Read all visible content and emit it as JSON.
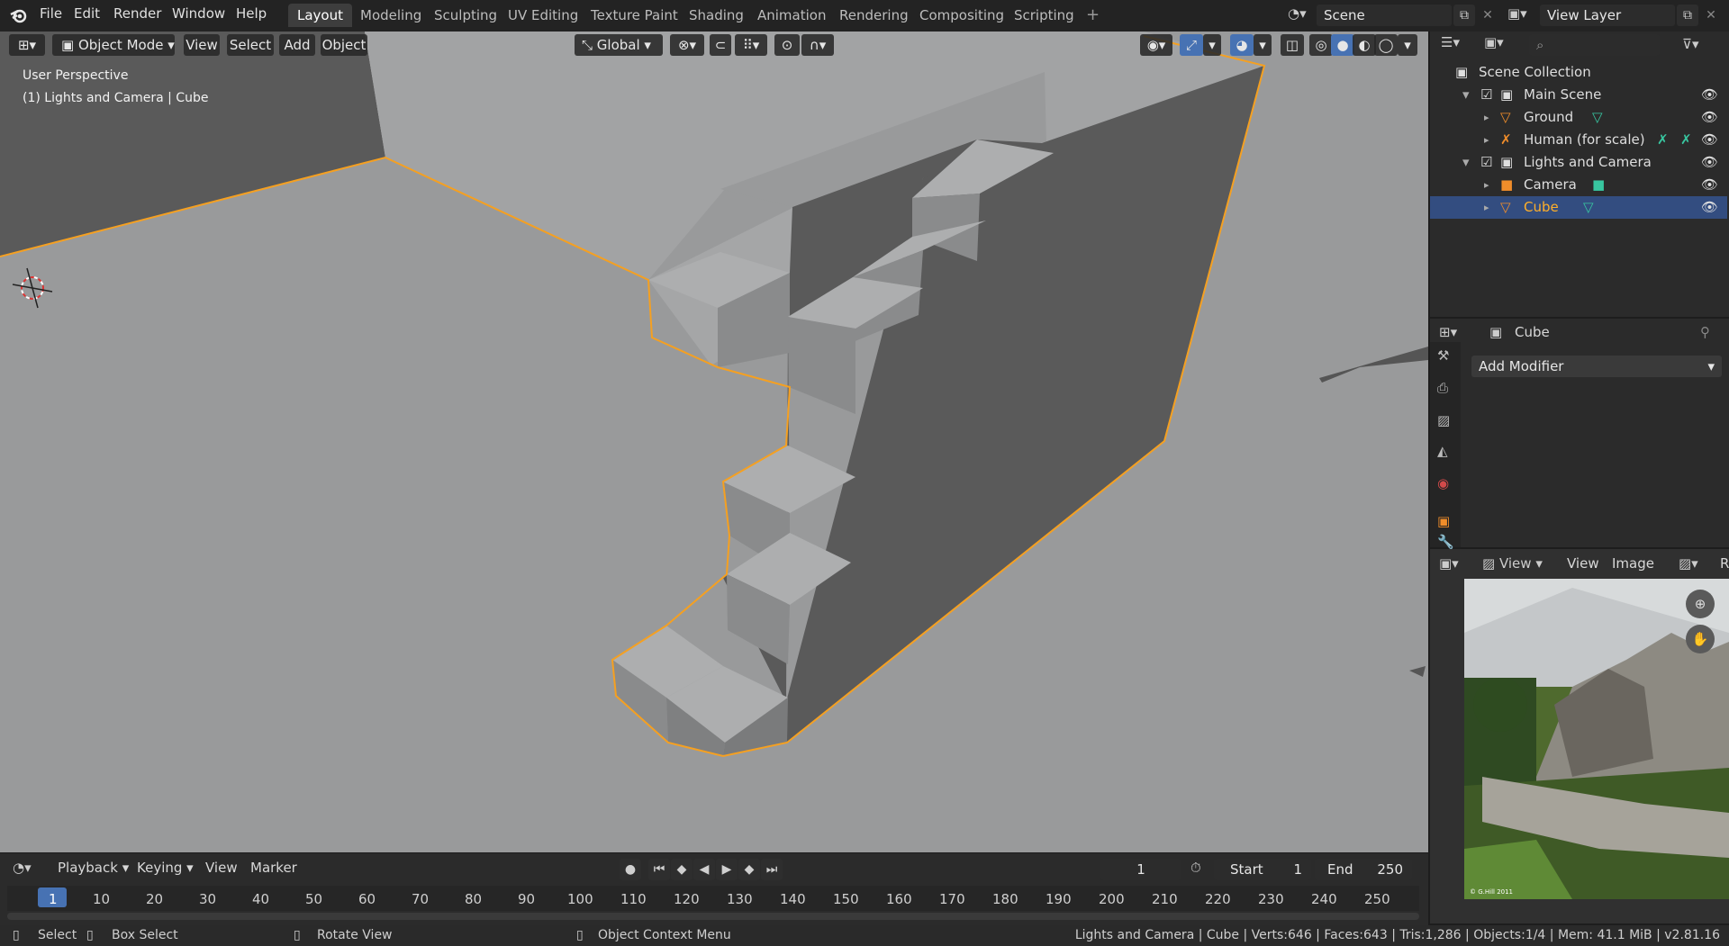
{
  "menu": {
    "file": "File",
    "edit": "Edit",
    "render": "Render",
    "window": "Window",
    "help": "Help"
  },
  "workspaces": [
    "Layout",
    "Modeling",
    "Sculpting",
    "UV Editing",
    "Texture Paint",
    "Shading",
    "Animation",
    "Rendering",
    "Compositing",
    "Scripting"
  ],
  "add_workspace": "+",
  "scene_field": "Scene",
  "view_layer_field": "View Layer",
  "viewport_header": {
    "mode": "Object Mode",
    "view": "View",
    "select": "Select",
    "add": "Add",
    "object": "Object",
    "orientation": "Global"
  },
  "viewport_overlay": {
    "perspective": "User Perspective",
    "context": "(1) Lights and Camera | Cube"
  },
  "outliner": {
    "root": "Scene Collection",
    "items": [
      {
        "label": "Main Scene",
        "type": "collection"
      },
      {
        "label": "Ground",
        "type": "mesh"
      },
      {
        "label": "Human (for scale)",
        "type": "armature"
      },
      {
        "label": "Lights and Camera",
        "type": "collection"
      },
      {
        "label": "Camera",
        "type": "camera"
      },
      {
        "label": "Cube",
        "type": "mesh",
        "selected": true
      }
    ]
  },
  "properties": {
    "object_name": "Cube",
    "add_modifier": "Add Modifier"
  },
  "image_editor": {
    "view_menu": "View",
    "view": "View",
    "image": "Image",
    "r": "R",
    "watermark": "© G.Hill 2011"
  },
  "timeline": {
    "playback": "Playback",
    "keying": "Keying",
    "view": "View",
    "marker": "Marker",
    "current_frame": "1",
    "start_label": "Start",
    "start_value": "1",
    "end_label": "End",
    "end_value": "250",
    "ruler": [
      "1",
      "10",
      "20",
      "30",
      "40",
      "50",
      "60",
      "70",
      "80",
      "90",
      "100",
      "110",
      "120",
      "130",
      "140",
      "150",
      "160",
      "170",
      "180",
      "190",
      "200",
      "210",
      "220",
      "230",
      "240",
      "250"
    ]
  },
  "statusbar": {
    "select": "Select",
    "box_select": "Box Select",
    "rotate_view": "Rotate View",
    "context_menu": "Object Context Menu",
    "stats": "Lights and Camera | Cube | Verts:646 | Faces:643 | Tris:1,286 | Objects:1/4 | Mem: 41.1 MiB | v2.81.16"
  },
  "colors": {
    "selection_outline": "#f5a021",
    "active_row": "#334d80",
    "active_text": "#ffaf29",
    "accent_frame": "#4772b3"
  }
}
